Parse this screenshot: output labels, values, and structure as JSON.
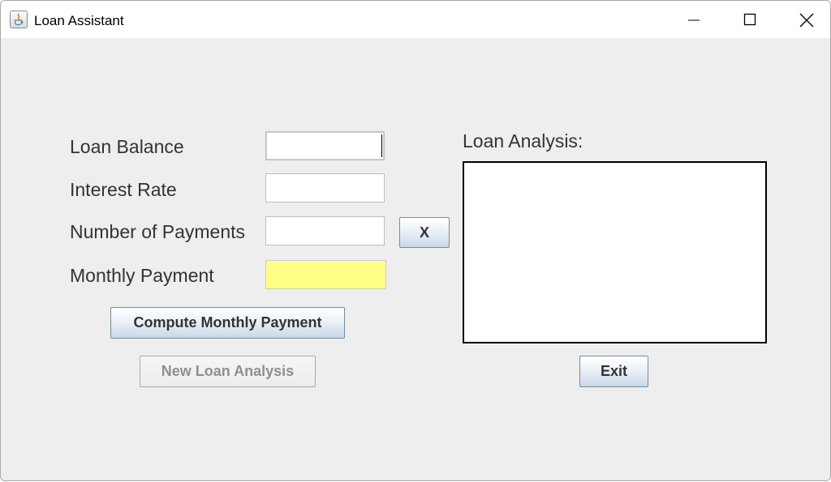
{
  "window": {
    "title": "Loan Assistant",
    "icon": "java-icon"
  },
  "form": {
    "loan_balance_label": "Loan Balance",
    "loan_balance_value": "",
    "interest_rate_label": "Interest Rate",
    "interest_rate_value": "",
    "number_of_payments_label": "Number of Payments",
    "number_of_payments_value": "",
    "monthly_payment_label": "Monthly Payment",
    "monthly_payment_value": "",
    "toggle_label": "X",
    "compute_label": "Compute Monthly Payment",
    "new_analysis_label": "New Loan Analysis"
  },
  "analysis": {
    "heading": "Loan Analysis:",
    "text": "",
    "exit_label": "Exit"
  },
  "colors": {
    "background": "#eeeeee",
    "monthly_payment_field": "#ffff88",
    "button_gradient_bottom": "#c9d8e7"
  }
}
